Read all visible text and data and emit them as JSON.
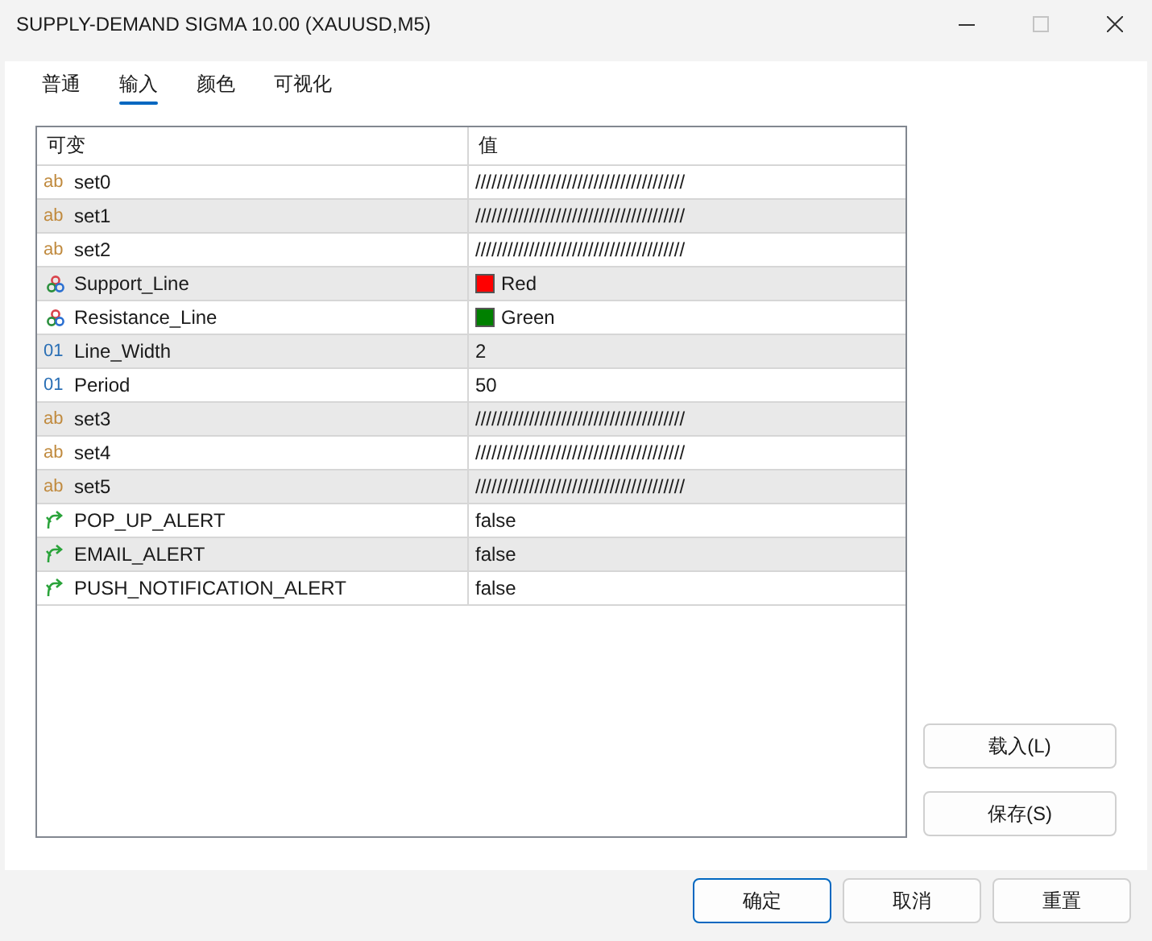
{
  "window": {
    "title": "SUPPLY-DEMAND SIGMA 10.00 (XAUUSD,M5)",
    "maximize_disabled": true
  },
  "tabs": [
    {
      "label": "普通",
      "selected": false
    },
    {
      "label": "输入",
      "selected": true
    },
    {
      "label": "颜色",
      "selected": false
    },
    {
      "label": "可视化",
      "selected": false
    }
  ],
  "table": {
    "columns": [
      "可变",
      "值"
    ],
    "rows": [
      {
        "kind": "string",
        "type_mark": "ab",
        "name": "set0",
        "value": "///////////////////////////////////////"
      },
      {
        "kind": "string",
        "type_mark": "ab",
        "name": "set1",
        "value": "///////////////////////////////////////"
      },
      {
        "kind": "string",
        "type_mark": "ab",
        "name": "set2",
        "value": "///////////////////////////////////////"
      },
      {
        "kind": "color",
        "name": "Support_Line",
        "value": "Red",
        "color": "#ff0000"
      },
      {
        "kind": "color",
        "name": "Resistance_Line",
        "value": "Green",
        "color": "#008000"
      },
      {
        "kind": "int",
        "type_mark": "01",
        "name": "Line_Width",
        "value": "2"
      },
      {
        "kind": "int",
        "type_mark": "01",
        "name": "Period",
        "value": "50"
      },
      {
        "kind": "string",
        "type_mark": "ab",
        "name": "set3",
        "value": "///////////////////////////////////////"
      },
      {
        "kind": "string",
        "type_mark": "ab",
        "name": "set4",
        "value": "///////////////////////////////////////"
      },
      {
        "kind": "string",
        "type_mark": "ab",
        "name": "set5",
        "value": "///////////////////////////////////////"
      },
      {
        "kind": "bool",
        "name": "POP_UP_ALERT",
        "value": "false"
      },
      {
        "kind": "bool",
        "name": "EMAIL_ALERT",
        "value": "false"
      },
      {
        "kind": "bool",
        "name": "PUSH_NOTIFICATION_ALERT",
        "value": "false"
      }
    ]
  },
  "side_buttons": [
    "载入(L)",
    "保存(S)"
  ],
  "footer_buttons": [
    {
      "label": "确定",
      "default": true
    },
    {
      "label": "取消",
      "default": false
    },
    {
      "label": "重置",
      "default": false
    }
  ]
}
